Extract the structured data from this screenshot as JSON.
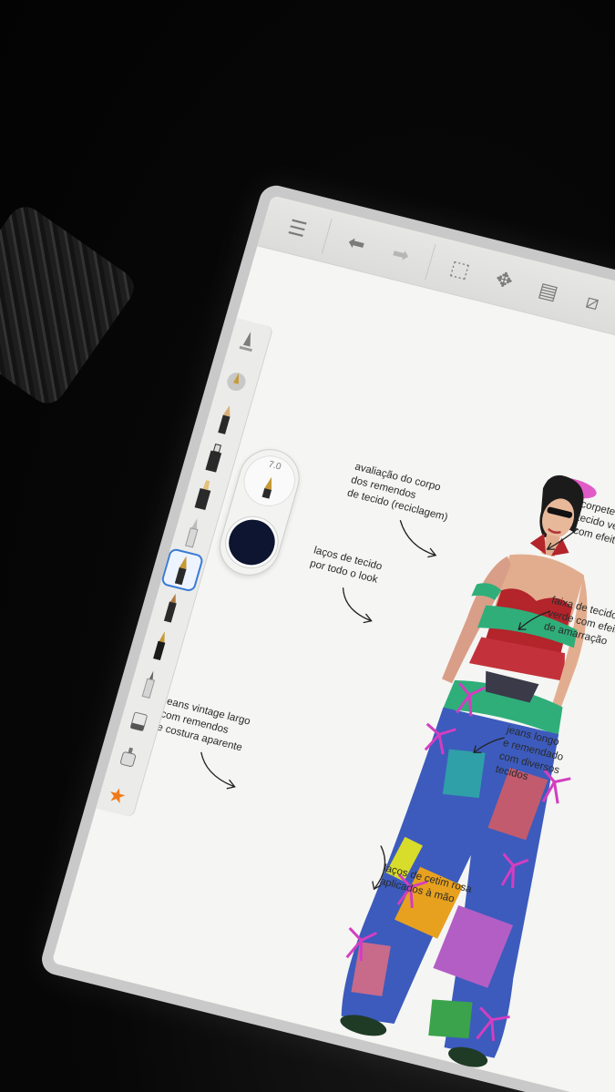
{
  "toolbar": {
    "icons": [
      "list-icon",
      "undo-icon",
      "redo-icon",
      "selection-icon",
      "transform-icon",
      "layers-icon",
      "ruler-icon",
      "symmetry-icon"
    ]
  },
  "brush_panel": {
    "size": "7.0",
    "color": "#0d1530"
  },
  "sidebar": {
    "selected_index": 6,
    "tools": [
      "brush-settings-icon",
      "pen-icon",
      "pencil-icon",
      "marker-icon",
      "felt-tip-icon",
      "brush-icon",
      "fountain-pen-icon",
      "chisel-marker-icon",
      "ink-pen-icon",
      "fineliner-icon",
      "eraser-icon",
      "airbrush-icon",
      "favorites-star-icon"
    ],
    "accent_color": "#3a7bd5",
    "star_color": "#f07a16"
  },
  "annotations": {
    "body_patches": "avaliação do corpo\ndos remendos\nde tecido (reciclagem)",
    "fabric_bows": "laços de tecido\npor todo o look",
    "jeans_vintage": "jeans vintage largo\ncom remendos\ne costura aparente",
    "corset": "corpete justo em\ntecido vermelho\ncom efeito de cetim",
    "green_sash": "faixa de tecido\nverde com efeito\nde amarração",
    "long_jeans": "jeans longo\ne remendado\ncom diversos\ntecidos",
    "satin_bows": "laços de cetim rosa\naplicados à mão"
  }
}
